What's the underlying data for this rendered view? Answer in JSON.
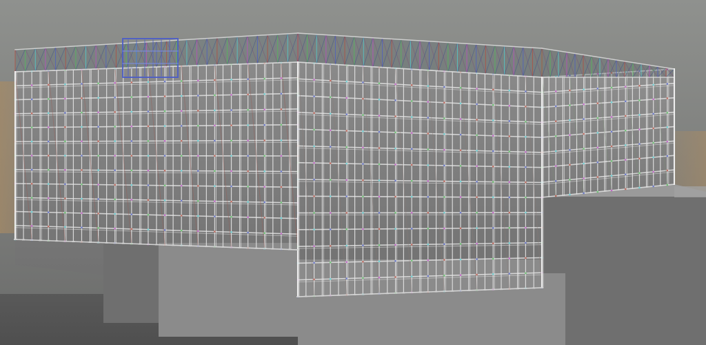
{
  "scene": {
    "subject": "3d-scaffolding-model",
    "colors": {
      "sky_top": "#8f918e",
      "sky_mid": "#7b7c7a",
      "sky_dusk": "#a58a66",
      "ground": "#585857",
      "plinth_front": "#8b8b8b",
      "plinth_side": "#6f6f6f",
      "plinth_top": "#9a9a9a",
      "wall_front": "#7d7d7d",
      "wall_side": "#8b8b8b",
      "scaffold_white": "#e6e6e6",
      "scaffold_blue": "#4a5cc8",
      "scaffold_red": "#b84a3a",
      "scaffold_green": "#4fbf57",
      "scaffold_cyan": "#4fd1d5",
      "scaffold_magenta": "#c04ac7"
    }
  }
}
